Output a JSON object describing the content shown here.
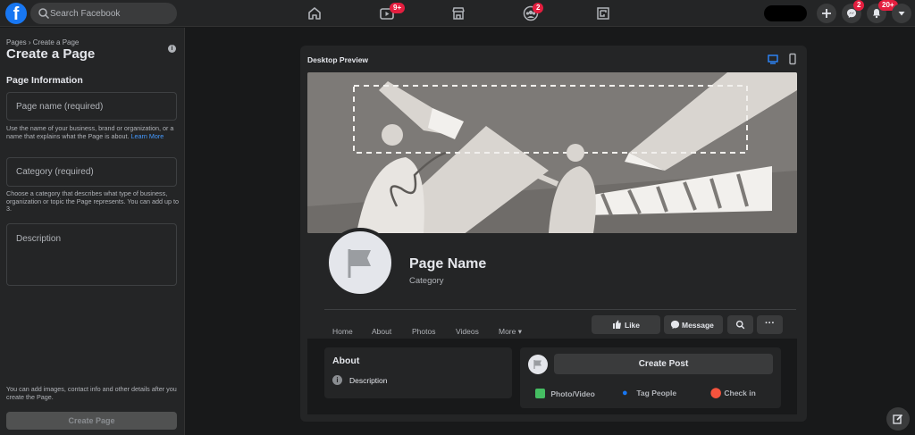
{
  "topbar": {
    "search_placeholder": "Search Facebook",
    "watch_badge": "9+",
    "groups_badge": "2",
    "messenger_badge": "2",
    "notifications_badge": "20+"
  },
  "left": {
    "breadcrumb": "Pages › Create a Page",
    "title": "Create a Page",
    "section": "Page Information",
    "name_placeholder": "Page name (required)",
    "name_help": "Use the name of your business, brand or organization, or a name that explains what the Page is about.",
    "learn_more": "Learn More",
    "category_placeholder": "Category (required)",
    "category_help": "Choose a category that describes what type of business, organization or topic the Page represents. You can add up to 3.",
    "description_placeholder": "Description",
    "bottom_note": "You can add images, contact info and other details after you create the Page.",
    "create_button": "Create Page"
  },
  "preview": {
    "title": "Desktop Preview",
    "page_name": "Page Name",
    "category": "Category",
    "tabs": [
      "Home",
      "About",
      "Photos",
      "Videos",
      "More"
    ],
    "like": "Like",
    "message": "Message",
    "about_title": "About",
    "about_description": "Description",
    "create_post": "Create Post",
    "photo_video": "Photo/Video",
    "tag_people": "Tag People",
    "check_in": "Check in"
  },
  "colors": {
    "brand": "#1877f2",
    "badge": "#e41e3f",
    "link": "#4599ff"
  }
}
